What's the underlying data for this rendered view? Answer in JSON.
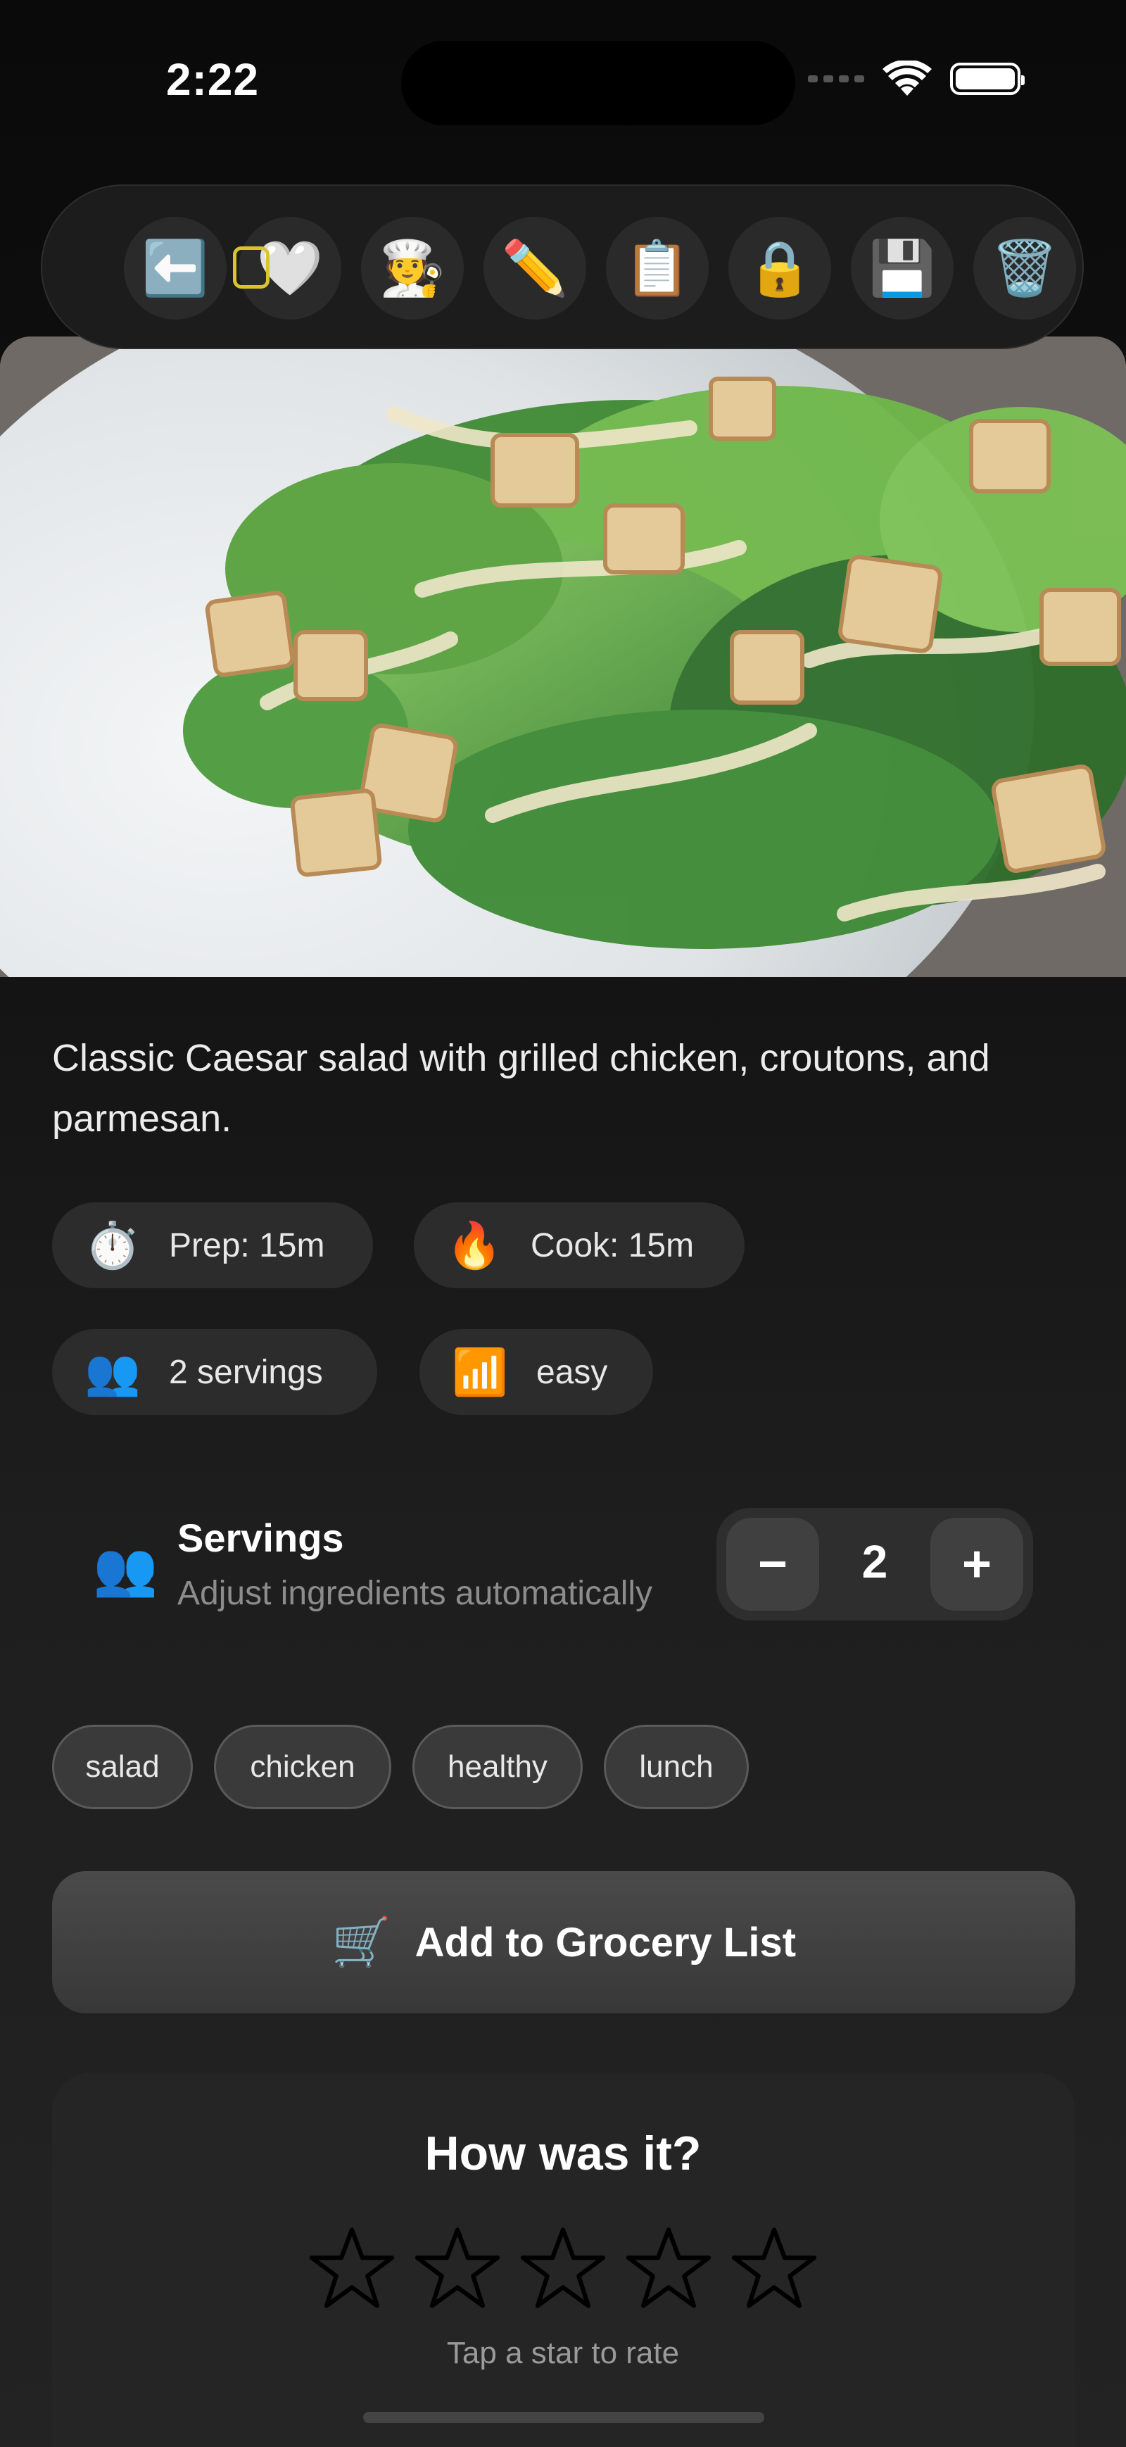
{
  "status_bar": {
    "time": "2:22"
  },
  "toolbar": {
    "buttons": [
      {
        "name": "back",
        "icon": "⬅️"
      },
      {
        "name": "favorite",
        "icon": "🤍"
      },
      {
        "name": "chef",
        "icon": "🧑‍🍳"
      },
      {
        "name": "edit",
        "icon": "✏️"
      },
      {
        "name": "clipboard",
        "icon": "📋"
      },
      {
        "name": "lock",
        "icon": "🔒"
      },
      {
        "name": "save",
        "icon": "💾"
      },
      {
        "name": "delete",
        "icon": "🗑️"
      }
    ]
  },
  "recipe": {
    "description": "Classic Caesar salad with grilled chicken, croutons, and parmesan.",
    "chips": {
      "prep": {
        "icon": "⏱️",
        "label": "Prep: 15m"
      },
      "cook": {
        "icon": "🔥",
        "label": "Cook: 15m"
      },
      "servings": {
        "icon": "👥",
        "label": "2 servings"
      },
      "difficulty": {
        "icon": "📶",
        "label": "easy"
      }
    }
  },
  "servings": {
    "icon": "👥",
    "title": "Servings",
    "subtitle": "Adjust ingredients automatically",
    "minus": "−",
    "value": "2",
    "plus": "+"
  },
  "tags": [
    "salad",
    "chicken",
    "healthy",
    "lunch"
  ],
  "grocery": {
    "icon": "🛒",
    "label": "Add to Grocery List"
  },
  "rating": {
    "title": "How was it?",
    "stars_filled": 0,
    "stars_total": 5,
    "hint": "Tap a star to rate"
  }
}
